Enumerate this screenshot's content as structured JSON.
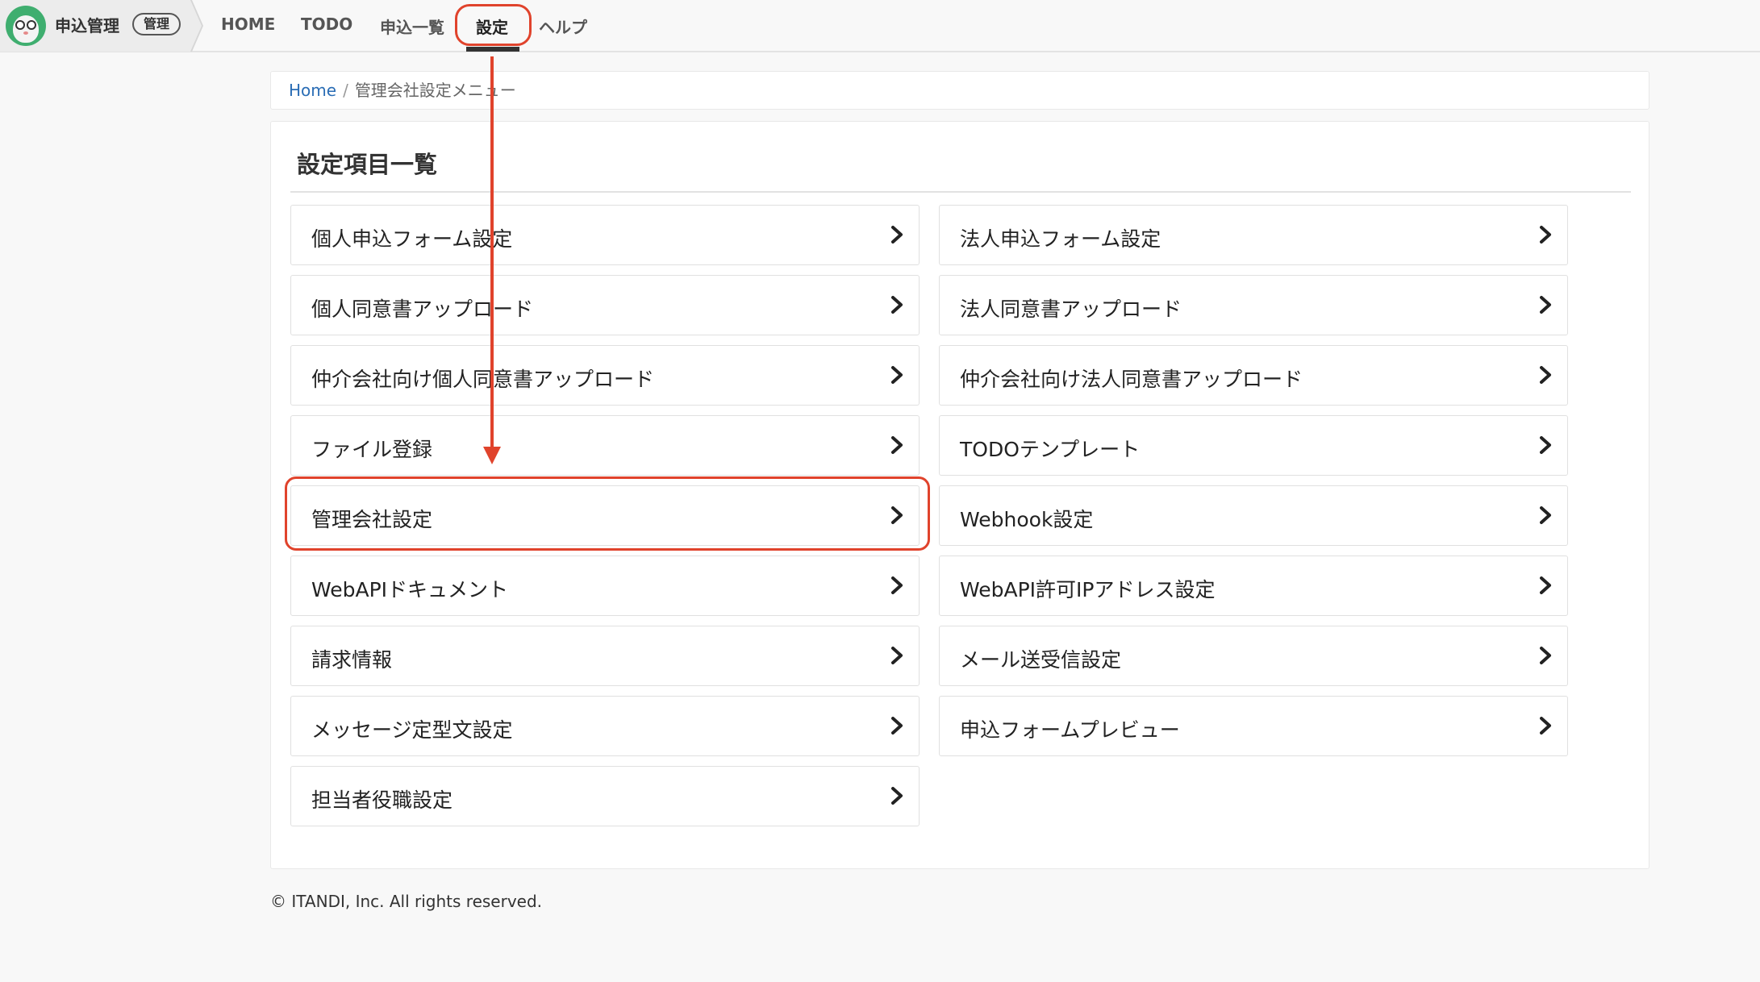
{
  "brand": {
    "title": "申込管理",
    "badge": "管理"
  },
  "nav": [
    {
      "label": "HOME"
    },
    {
      "label": "TODO"
    },
    {
      "label": "申込一覧"
    },
    {
      "label": "設定"
    },
    {
      "label": "ヘルプ"
    }
  ],
  "breadcrumb": {
    "home": "Home",
    "separator": "/",
    "current": "管理会社設定メニュー"
  },
  "panel": {
    "title": "設定項目一覧"
  },
  "items_left": [
    {
      "label": "個人申込フォーム設定"
    },
    {
      "label": "個人同意書アップロード"
    },
    {
      "label": "仲介会社向け個人同意書アップロード"
    },
    {
      "label": "ファイル登録"
    },
    {
      "label": "管理会社設定"
    },
    {
      "label": "WebAPIドキュメント"
    },
    {
      "label": "請求情報"
    },
    {
      "label": "メッセージ定型文設定"
    },
    {
      "label": "担当者役職設定"
    }
  ],
  "items_right": [
    {
      "label": "法人申込フォーム設定"
    },
    {
      "label": "法人同意書アップロード"
    },
    {
      "label": "仲介会社向け法人同意書アップロード"
    },
    {
      "label": "TODOテンプレート"
    },
    {
      "label": "Webhook設定"
    },
    {
      "label": "WebAPI許可IPアドレス設定"
    },
    {
      "label": "メール送受信設定"
    },
    {
      "label": "申込フォームプレビュー"
    }
  ],
  "footer": {
    "text": "© ITANDI, Inc. All rights reserved."
  },
  "colors": {
    "annotation": "#e0432c",
    "link": "#2a6db5",
    "logo": "#3fae6f"
  },
  "icons": {
    "item": "chevron-right-icon",
    "logo": "frog-mascot-icon"
  }
}
